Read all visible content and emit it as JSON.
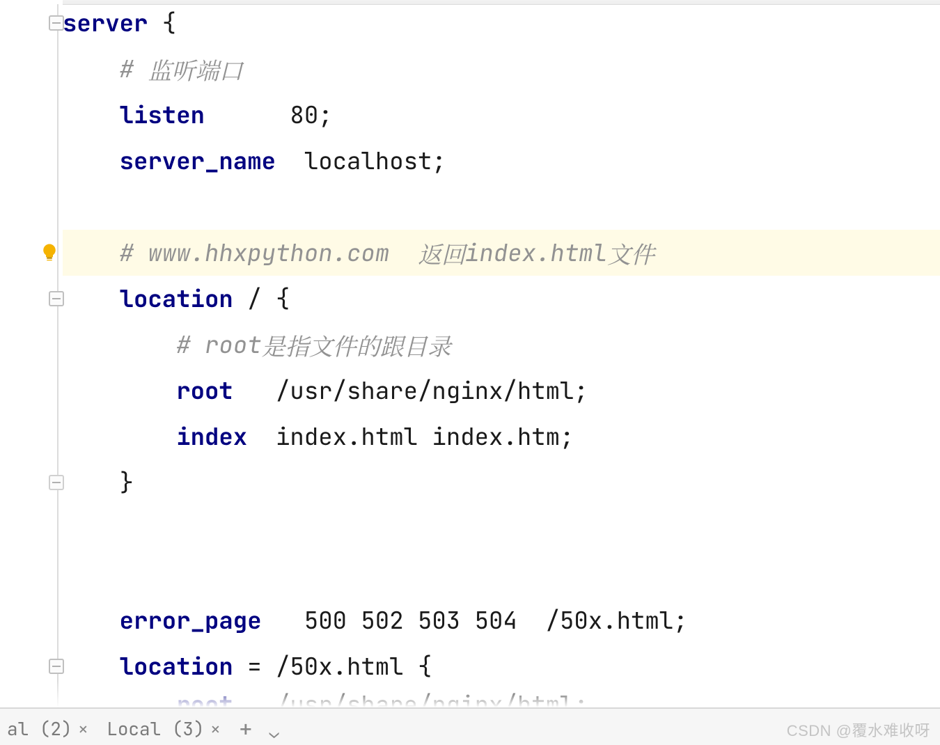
{
  "code": {
    "l1_kw": "server",
    "l1_brace": " {",
    "l2_hash": "# ",
    "l2_cn": "监听端口",
    "l3_kw": "listen",
    "l3_gap": "      ",
    "l3_val": "80;",
    "l4_kw": "server_name",
    "l4_gap": "  ",
    "l4_val": "localhost;",
    "l5_hash": "# ",
    "l5_txt": "www.hhxpython.com  ",
    "l5_cn1": "返回",
    "l5_mid": "index.html",
    "l5_cn2": "文件",
    "l6_kw": "location",
    "l6_rest": " / {",
    "l7_hash": "# ",
    "l7_txt": "root",
    "l7_cn": "是指文件的跟目录",
    "l8_kw": "root",
    "l8_gap": "   ",
    "l8_val": "/usr/share/nginx/html;",
    "l9_kw": "index",
    "l9_gap": "  ",
    "l9_val": "index.html index.htm;",
    "l10_brace": "}",
    "l11_kw": "error_page",
    "l11_gap": "   ",
    "l11_val": "500 502 503 504  /50x.html;",
    "l12_kw": "location",
    "l12_rest": " = /50x.html {",
    "l13_kw": "root",
    "l13_gap": "   ",
    "l13_val": "/usr/share/nginx/html;"
  },
  "status": {
    "tab1": "al (2)",
    "tab2": "Local (3)"
  },
  "watermark": "CSDN @覆水难收呀"
}
